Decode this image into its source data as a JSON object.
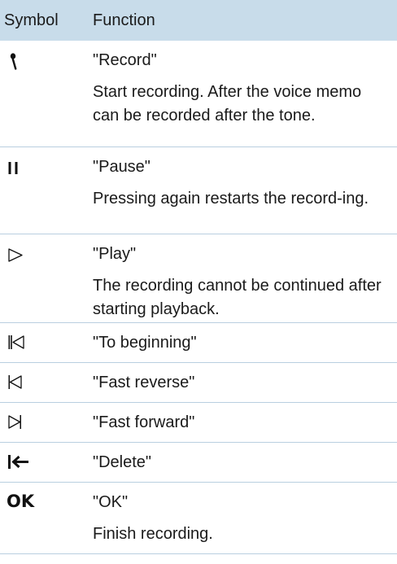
{
  "header": {
    "symbol": "Symbol",
    "function": "Function"
  },
  "rows": [
    {
      "icon": "microphone-icon",
      "title": "\"Record\"",
      "desc": "Start recording. After the voice memo can be recorded after the tone."
    },
    {
      "icon": "pause-icon",
      "title": "\"Pause\"",
      "desc": "Pressing again restarts the record-ing."
    },
    {
      "icon": "play-icon",
      "title": "\"Play\"",
      "desc": "The recording cannot be continued after starting playback."
    },
    {
      "icon": "to-beginning-icon",
      "title": "\"To beginning\""
    },
    {
      "icon": "fast-reverse-icon",
      "title": "\"Fast reverse\""
    },
    {
      "icon": "fast-forward-icon",
      "title": "\"Fast forward\""
    },
    {
      "icon": "delete-icon",
      "title": "\"Delete\""
    },
    {
      "icon": "ok-icon",
      "symbol_text": "OK",
      "title": "\"OK\"",
      "desc": "Finish recording."
    }
  ],
  "colors": {
    "header_bg": "#c8dcea",
    "divider": "#b9cfe0"
  }
}
